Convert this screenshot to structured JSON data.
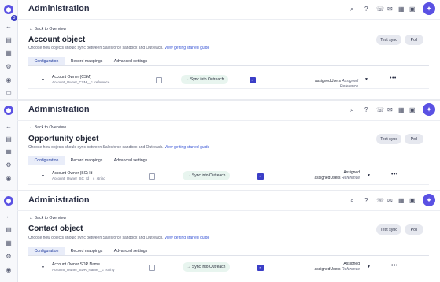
{
  "rail_icons": {
    "logo": "shield-logo-icon",
    "badge": "3",
    "items": [
      "back-arrow-icon",
      "table-icon",
      "building-icon",
      "user-gear-icon",
      "camera-icon",
      "document-icon"
    ]
  },
  "panels": [
    {
      "app_title": "Administration",
      "back": "Back to Overview",
      "object_title": "Account object",
      "description": "Choose how objects should sync between Salesforce sandbox and Outreach.",
      "guide_link": "View getting started guide",
      "test_sync": "Test sync",
      "poll": "Poll",
      "tabs": [
        "Configuration",
        "Record mappings",
        "Advanced settings"
      ],
      "row": {
        "field_name": "Account Owner (CSM)",
        "field_api": "Account_Owner_CSM__c",
        "field_type": "reference",
        "sync_label": "Sync into Outreach",
        "assigned_top": "",
        "assigned_users": "assignedUsers",
        "assigned_type": "Assigned Reference"
      }
    },
    {
      "app_title": "Administration",
      "back": "Back to Overview",
      "object_title": "Opportunity object",
      "description": "Choose how objects should sync between Salesforce sandbox and Outreach.",
      "guide_link": "View getting started guide",
      "test_sync": "Test sync",
      "poll": "Poll",
      "tabs": [
        "Configuration",
        "Record mappings",
        "Advanced settings"
      ],
      "row": {
        "field_name": "Account Owner (SC) Id",
        "field_api": "Account_Owner_SC_Id__c",
        "field_type": "string",
        "sync_label": "Sync into Outreach",
        "assigned_top": "Assigned",
        "assigned_users": "assignedUsers",
        "assigned_type": "Reference"
      }
    },
    {
      "app_title": "Administration",
      "back": "Back to Overview",
      "object_title": "Contact object",
      "description": "Choose how objects should sync between Salesforce sandbox and Outreach.",
      "guide_link": "View getting started guide",
      "test_sync": "Test sync",
      "poll": "Poll",
      "tabs": [
        "Configuration",
        "Record mappings",
        "Advanced settings"
      ],
      "row": {
        "field_name": "Account Owner SDR Name",
        "field_api": "Account_Owner_SDR_Name__c",
        "field_type": "string",
        "sync_label": "Sync into Outreach",
        "assigned_top": "Assigned",
        "assigned_users": "assignedUsers",
        "assigned_type": "Reference"
      }
    }
  ],
  "toolbar_icons": [
    "search-icon",
    "help-icon",
    "phone-icon",
    "mail-icon",
    "calendar-icon",
    "calendar-check-icon",
    "sparkle-icon"
  ],
  "colors": {
    "accent": "#5a51e3",
    "link": "#3653d4",
    "sync_pill": "#e8f5ef"
  }
}
